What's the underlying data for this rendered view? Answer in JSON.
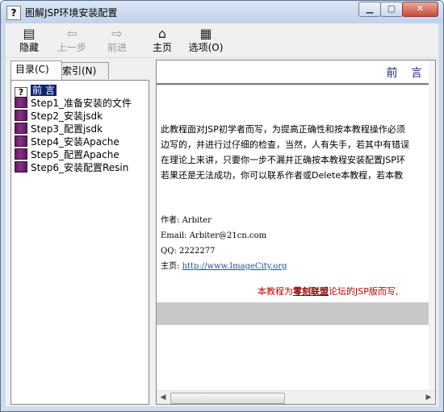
{
  "window": {
    "title": "图解JSP环境安装配置",
    "controls": {
      "minimize": "▁",
      "maximize": "▢",
      "close": "✕"
    }
  },
  "toolbar": {
    "hide": "隐藏",
    "back": "上一步",
    "forward": "前进",
    "home": "主页",
    "options": "选项(O)"
  },
  "nav_tabs": {
    "contents": "目录(C)",
    "index": "索引(N)"
  },
  "tree": {
    "items": [
      {
        "label": "前 言",
        "icon": "help-page-icon",
        "selected": true
      },
      {
        "label": "Step1_准备安装的文件",
        "icon": "book-icon"
      },
      {
        "label": "Step2_安装jsdk",
        "icon": "book-icon"
      },
      {
        "label": "Step3_配置jsdk",
        "icon": "book-icon"
      },
      {
        "label": "Step4_安装Apache",
        "icon": "book-icon"
      },
      {
        "label": "Step5_配置Apache",
        "icon": "book-icon"
      },
      {
        "label": "Step6_安装配置Resin",
        "icon": "book-icon"
      }
    ]
  },
  "content": {
    "heading": "前 言",
    "paragraph_lines": [
      "此教程面对JSP初学者而写，为提高正确性和按本教程操作必须",
      "边写的，并进行过仔细的检查，当然，人有失手，若其中有错误",
      "在理论上来讲，只要你一步不漏并正确按本教程安装配置JSP环",
      "若果还是无法成功，你可以联系作者或Delete本教程，若本教"
    ],
    "author_label": "作者: ",
    "author": "Arbiter",
    "email_label": "Email: ",
    "email": "Arbiter@21cn.com",
    "qq_label": "QQ: ",
    "qq": "2222277",
    "homepage_label": "主页: ",
    "homepage": "http://www.ImageCity.org",
    "note_prefix": "本教程为",
    "note_link": "零刻联盟",
    "note_suffix": "论坛的JSP版而写,"
  }
}
